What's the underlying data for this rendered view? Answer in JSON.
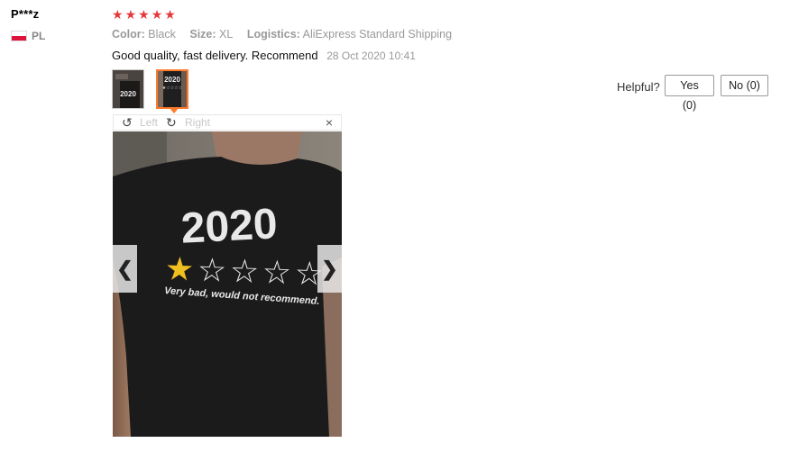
{
  "user": {
    "name": "P***z",
    "country": "PL"
  },
  "review": {
    "rating": 5,
    "star_glyph": "★",
    "color_label": "Color:",
    "color_value": "Black",
    "size_label": "Size:",
    "size_value": "XL",
    "logistics_label": "Logistics:",
    "logistics_value": "AliExpress Standard Shipping",
    "text": "Good quality, fast delivery. Recommend",
    "date": "28 Oct 2020 10:41"
  },
  "helpful": {
    "label": "Helpful?",
    "yes_label": "Yes (0)",
    "no_label": "No (0)"
  },
  "viewer": {
    "rotate_left_label": "Left",
    "rotate_right_label": "Right",
    "close_glyph": "×",
    "prev_glyph": "❮",
    "next_glyph": "❯"
  },
  "photo": {
    "shirt_year": "2020",
    "shirt_caption": "Very bad, would not recommend."
  },
  "colors": {
    "accent": "#ff7b2c",
    "star": "#e4393c",
    "rating_star_gold": "#f0c020"
  }
}
